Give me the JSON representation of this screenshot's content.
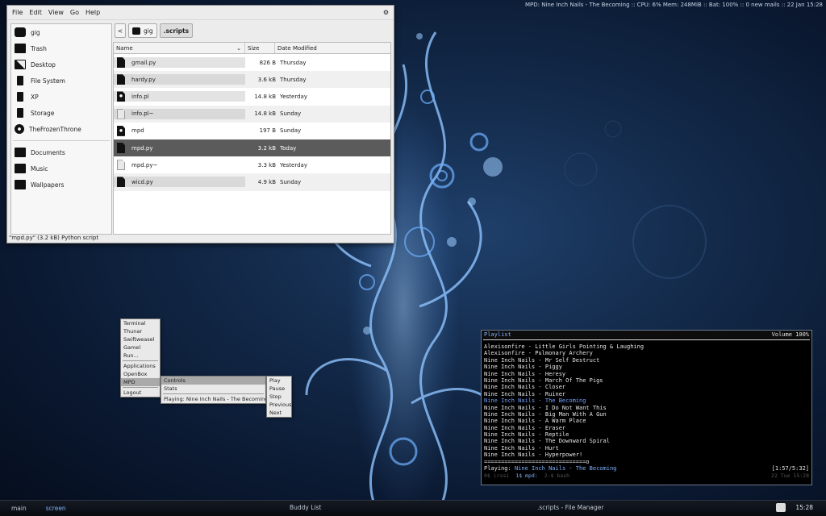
{
  "topbar": {
    "status": "MPD: Nine Inch Nails - The Becoming :: CPU: 6% Mem: 248MiB :: Bat: 100% :: 0 new mails :: 22 Jan 15:28"
  },
  "file_manager": {
    "menu": [
      "File",
      "Edit",
      "View",
      "Go",
      "Help"
    ],
    "sidebar": [
      {
        "label": "gig",
        "icon": "home-folder-icon"
      },
      {
        "label": "Trash",
        "icon": "trash-icon"
      },
      {
        "label": "Desktop",
        "icon": "desktop-icon"
      },
      {
        "label": "File System",
        "icon": "filesystem-icon"
      },
      {
        "label": "XP",
        "icon": "drive-icon"
      },
      {
        "label": "Storage",
        "icon": "drive-icon"
      },
      {
        "label": "TheFrozenThrone",
        "icon": "cdrom-icon"
      },
      {
        "label": "Documents",
        "icon": "folder-icon"
      },
      {
        "label": "Music",
        "icon": "folder-icon"
      },
      {
        "label": "Wallpapers",
        "icon": "folder-icon"
      }
    ],
    "path": {
      "back": "<",
      "home": "gig",
      "current": ".scripts"
    },
    "columns": {
      "name": "Name",
      "size": "Size",
      "modified": "Date Modified"
    },
    "files": [
      {
        "name": "gmail.py",
        "size": "826 B",
        "modified": "Thursday",
        "icon": "python-file-icon"
      },
      {
        "name": "hardy.py",
        "size": "3.6 kB",
        "modified": "Thursday",
        "icon": "python-file-icon"
      },
      {
        "name": "info.pl",
        "size": "14.8 kB",
        "modified": "Yesterday",
        "icon": "executable-icon"
      },
      {
        "name": "info.pl~",
        "size": "14.8 kB",
        "modified": "Sunday",
        "icon": "backup-file-icon"
      },
      {
        "name": "mpd",
        "size": "197 B",
        "modified": "Sunday",
        "icon": "executable-icon"
      },
      {
        "name": "mpd.py",
        "size": "3.2 kB",
        "modified": "Today",
        "icon": "python-file-icon"
      },
      {
        "name": "mpd.py~",
        "size": "3.3 kB",
        "modified": "Yesterday",
        "icon": "backup-file-icon"
      },
      {
        "name": "wicd.py",
        "size": "4.9 kB",
        "modified": "Sunday",
        "icon": "python-file-icon"
      }
    ],
    "status": "\"mpd.py\" (3.2 kB) Python script"
  },
  "openbox_menu": {
    "root": [
      "Terminal",
      "Thunar",
      "Swiftweasel",
      "Gamel",
      "Run..."
    ],
    "root2": [
      "Applications",
      "OpenBox",
      "MPD"
    ],
    "logout": "Logout",
    "mpd": [
      "Controls",
      "Stats"
    ],
    "mpd_playing": "Playing: Nine Inch Nails - The Becoming",
    "controls": [
      "Play",
      "Pause",
      "Stop",
      "Previous",
      "Next"
    ]
  },
  "terminal": {
    "title": "Playlist",
    "volume": "Volume 100%",
    "tracks": [
      "Alexisonfire - Little Girls Pointing & Laughing",
      "Alexisonfire - Pulmonary Archery",
      "Nine Inch Nails - Mr Self Destruct",
      "Nine Inch Nails - Piggy",
      "Nine Inch Nails - Heresy",
      "Nine Inch Nails - March Of The Pigs",
      "Nine Inch Nails - Closer",
      "Nine Inch Nails - Ruiner",
      "Nine Inch Nails - The Becoming",
      "Nine Inch Nails - I Do Not Want This",
      "Nine Inch Nails - Big Man With A Gun",
      "Nine Inch Nails - A Warm Place",
      "Nine Inch Nails - Eraser",
      "Nine Inch Nails - Reptile",
      "Nine Inch Nails - The Downward Spiral",
      "Nine Inch Nails - Hurt",
      "Nine Inch Nails - Hyperpower!"
    ],
    "current_index": 8,
    "progress": "==============================o",
    "playing_label": "Playing:",
    "now_playing": "Nine Inch Nails - The Becoming",
    "time": "[1:57/5:32]",
    "screen_windows": [
      "0$ irssi",
      "1$ mpd:",
      "2-$ bash"
    ],
    "screen_clock": "22 Tue 15:28"
  },
  "taskbar": {
    "workspaces": [
      "main",
      "screen"
    ],
    "tasks": [
      "Buddy List",
      ".scripts - File Manager"
    ],
    "clock": "15:28"
  }
}
